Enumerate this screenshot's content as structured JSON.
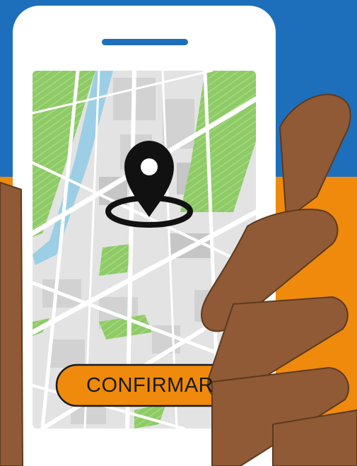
{
  "colors": {
    "background_top": "#1e6fbb",
    "background_bottom": "#ef8a0c",
    "phone_body": "#ffffff",
    "speaker": "#1e6fbb",
    "map_base": "#e6e6e6",
    "map_park": "#8ecb67",
    "map_water": "#9ccfe6",
    "map_road": "#ffffff",
    "pin": "#111111",
    "button": "#ef8a0c",
    "hand": "#8f5a35",
    "hand_outline": "#5e3a1f"
  },
  "icons": {
    "location": "map-pin-icon"
  },
  "button": {
    "label": "CONFIRMAR"
  }
}
